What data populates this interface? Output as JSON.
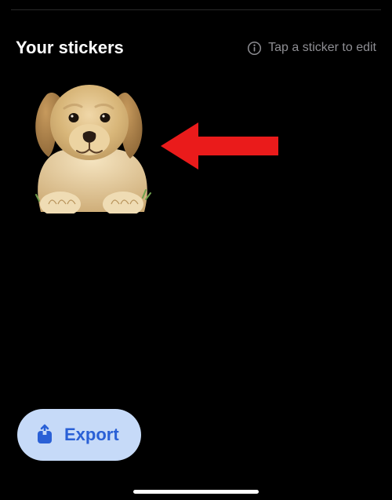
{
  "header": {
    "title": "Your stickers",
    "hint": "Tap a sticker to edit"
  },
  "sticker": {
    "name": "puppy-sticker"
  },
  "annotation": {
    "name": "arrow-pointing-to-sticker",
    "color": "#ea1b1b"
  },
  "export": {
    "label": "Export"
  }
}
